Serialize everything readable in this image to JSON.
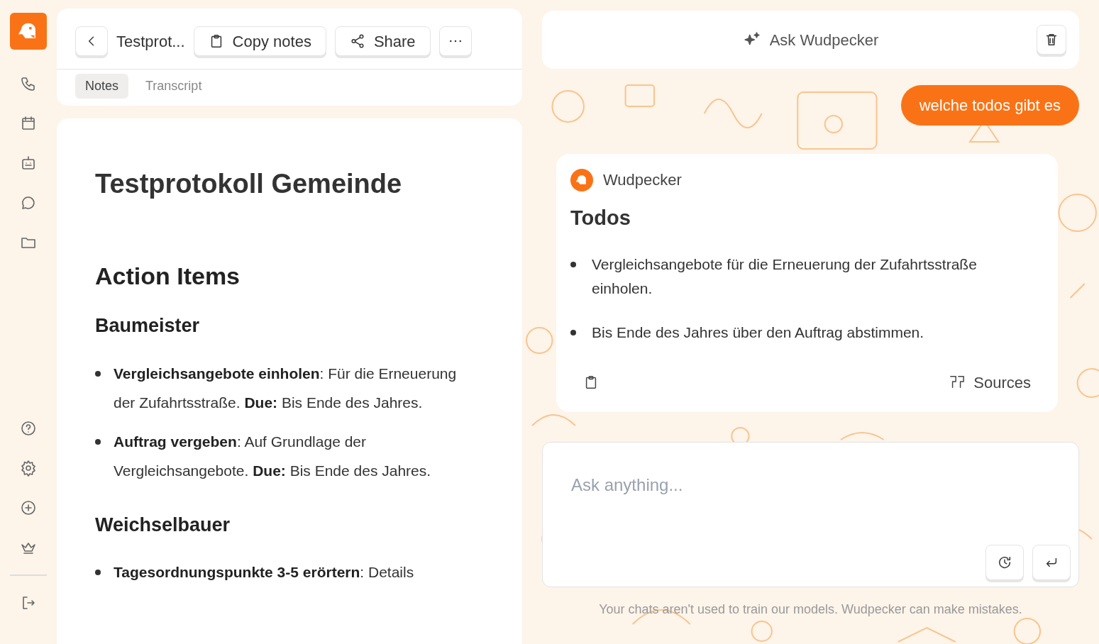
{
  "header": {
    "title": "Testprot...",
    "buttons": [
      {
        "kind": "copy",
        "label": "Copy notes"
      },
      {
        "kind": "share",
        "label": "Share"
      }
    ]
  },
  "tabs": [
    {
      "label": "Notes",
      "selected": true
    },
    {
      "label": "Transcript",
      "selected": false
    }
  ],
  "document": {
    "title": "Testprotokoll Gemeinde",
    "blocks": [
      {
        "kind": "h2",
        "text": "Action Items"
      },
      {
        "kind": "h3",
        "text": "Baumeister"
      },
      {
        "kind": "bullet",
        "text": "**Vergleichsangebote einholen**: Für die Erneuerung der Zufahrtsstraße. **Due:** Bis Ende des Jahres."
      },
      {
        "kind": "bullet",
        "text": "**Auftrag vergeben**: Auf Grundlage der Vergleichsangebote. **Due:** Bis Ende des Jahres."
      },
      {
        "kind": "h3",
        "text": "Weichselbauer"
      },
      {
        "kind": "bullet",
        "text": "**Tagesordnungspunkte 3-5 erörtern**: Details"
      }
    ]
  },
  "chat": {
    "title": "Ask Wudpecker",
    "messages": [
      {
        "kind": "user",
        "text": "welche todos gibt es"
      },
      {
        "kind": "assistant",
        "sender": "Wudpecker",
        "heading": "Todos",
        "items": [
          "Vergleichsangebote für die Erneuerung der Zufahrtsstraße einholen.",
          "Bis Ende des Jahres über den Auftrag abstimmen."
        ],
        "sources": "Sources"
      }
    ],
    "input": {
      "placeholder": "Ask anything..."
    },
    "disclaimer": "Your chats aren't used to train our models. Wudpecker can make mistakes."
  }
}
